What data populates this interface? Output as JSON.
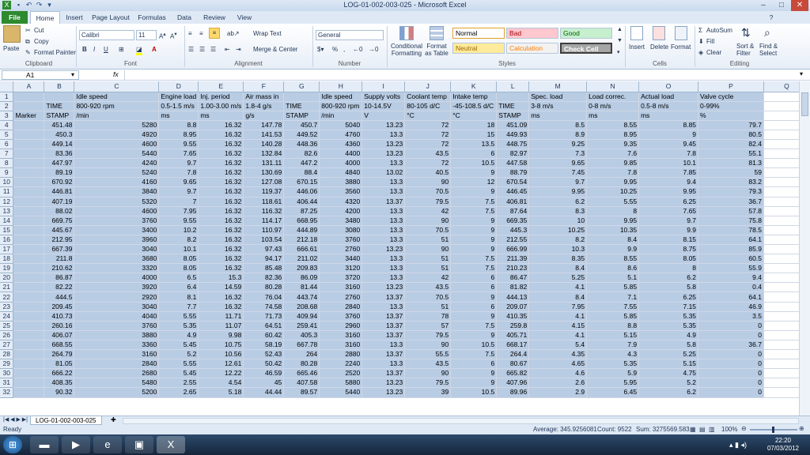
{
  "window": {
    "title": "LOG-01-002-003-025  -  Microsoft Excel"
  },
  "tabs": [
    "File",
    "Home",
    "Insert",
    "Page Layout",
    "Formulas",
    "Data",
    "Review",
    "View"
  ],
  "ribbon": {
    "clipboard": {
      "paste": "Paste",
      "cut": "Cut",
      "copy": "Copy",
      "format_painter": "Format Painter",
      "label": "Clipboard"
    },
    "font": {
      "name": "Calibri",
      "size": "11",
      "label": "Font",
      "bold": "B",
      "italic": "I",
      "underline": "U"
    },
    "alignment": {
      "wrap": "Wrap Text",
      "merge": "Merge & Center",
      "label": "Alignment"
    },
    "number": {
      "format": "General",
      "label": "Number",
      "percent": "%",
      "comma": ","
    },
    "styles": {
      "cond": "Conditional Formatting",
      "table": "Format as Table",
      "label": "Styles",
      "cells": [
        {
          "text": "Normal",
          "bg": "#ffffff",
          "fg": "#000000"
        },
        {
          "text": "Bad",
          "bg": "#ffc7ce",
          "fg": "#9c0006"
        },
        {
          "text": "Good",
          "bg": "#c6efce",
          "fg": "#006100"
        },
        {
          "text": "Neutral",
          "bg": "#ffeb9c",
          "fg": "#9c6500"
        },
        {
          "text": "Calculation",
          "bg": "#f2f2f2",
          "fg": "#fa7d00"
        },
        {
          "text": "Check Cell",
          "bg": "#a5a5a5",
          "fg": "#ffffff"
        }
      ]
    },
    "cells": {
      "insert": "Insert",
      "delete": "Delete",
      "format": "Format",
      "label": "Cells"
    },
    "editing": {
      "autosum": "AutoSum",
      "fill": "Fill",
      "clear": "Clear",
      "sort": "Sort & Filter",
      "find": "Find & Select",
      "label": "Editing"
    }
  },
  "namebox": "A1",
  "fx": "fx",
  "columns": [
    "A",
    "B",
    "C",
    "D",
    "E",
    "F",
    "G",
    "H",
    "I",
    "J",
    "K",
    "L",
    "M",
    "N",
    "O",
    "P",
    "Q"
  ],
  "header_rows": [
    [
      "",
      "",
      "Idle speed",
      "Engine load",
      "Inj. period",
      "Air mass in",
      "",
      "Idle speed",
      "Supply volts",
      "Coolant temp",
      "Intake temp",
      "",
      "Spec. load",
      "Load correc.",
      "Actual load",
      "Valve cycle",
      ""
    ],
    [
      "",
      "TIME",
      "800-920 rpm",
      "0.5-1.5 m/s",
      "1.00-3.00 m/s",
      "1.8-4 g/s",
      "TIME",
      "800-920 rpm",
      "10-14.5V",
      "80-105 d/C",
      "-45-108.5 d/C",
      "TIME",
      "3-8 m/s",
      "0-8 m/s",
      "0.5-8 m/s",
      "0-99%",
      ""
    ],
    [
      "Marker",
      "STAMP",
      "/min",
      "ms",
      "ms",
      "g/s",
      "STAMP",
      "/min",
      "V",
      "°C",
      "°C",
      "STAMP",
      "ms",
      "ms",
      "ms",
      "%",
      ""
    ]
  ],
  "data_rows": [
    [
      "451.48",
      "5280",
      "8.8",
      "16.32",
      "147.78",
      "450.7",
      "5040",
      "13.23",
      "72",
      "18",
      "451.09",
      "8.5",
      "8.55",
      "8.85",
      "79.7"
    ],
    [
      "450.3",
      "4920",
      "8.95",
      "16.32",
      "141.53",
      "449.52",
      "4760",
      "13.3",
      "72",
      "15",
      "449.93",
      "8.9",
      "8.95",
      "9",
      "80.5"
    ],
    [
      "449.14",
      "4600",
      "9.55",
      "16.32",
      "140.28",
      "448.36",
      "4360",
      "13.23",
      "72",
      "13.5",
      "448.75",
      "9.25",
      "9.35",
      "9.45",
      "82.4"
    ],
    [
      "83.36",
      "5440",
      "7.65",
      "16.32",
      "132.84",
      "82.6",
      "4400",
      "13.23",
      "43.5",
      "6",
      "82.97",
      "7.3",
      "7.6",
      "7.8",
      "55.1"
    ],
    [
      "447.97",
      "4240",
      "9.7",
      "16.32",
      "131.11",
      "447.2",
      "4000",
      "13.3",
      "72",
      "10.5",
      "447.58",
      "9.65",
      "9.85",
      "10.1",
      "81.3"
    ],
    [
      "89.19",
      "5240",
      "7.8",
      "16.32",
      "130.69",
      "88.4",
      "4840",
      "13.02",
      "40.5",
      "9",
      "88.79",
      "7.45",
      "7.8",
      "7.85",
      "59"
    ],
    [
      "670.92",
      "4160",
      "9.65",
      "16.32",
      "127.08",
      "670.15",
      "3880",
      "13.3",
      "90",
      "12",
      "670.54",
      "9.7",
      "9.95",
      "9.4",
      "83.2"
    ],
    [
      "446.81",
      "3840",
      "9.7",
      "16.32",
      "119.37",
      "446.06",
      "3560",
      "13.3",
      "70.5",
      "9",
      "446.45",
      "9.95",
      "10.25",
      "9.95",
      "79.3"
    ],
    [
      "407.19",
      "5320",
      "7",
      "16.32",
      "118.61",
      "406.44",
      "4320",
      "13.37",
      "79.5",
      "7.5",
      "406.81",
      "6.2",
      "5.55",
      "6.25",
      "36.7"
    ],
    [
      "88.02",
      "4600",
      "7.95",
      "16.32",
      "116.32",
      "87.25",
      "4200",
      "13.3",
      "42",
      "7.5",
      "87.64",
      "8.3",
      "8",
      "7.65",
      "57.8"
    ],
    [
      "669.75",
      "3760",
      "9.55",
      "16.32",
      "114.17",
      "668.95",
      "3480",
      "13.3",
      "90",
      "9",
      "669.35",
      "10",
      "9.95",
      "9.7",
      "75.8"
    ],
    [
      "445.67",
      "3400",
      "10.2",
      "16.32",
      "110.97",
      "444.89",
      "3080",
      "13.3",
      "70.5",
      "9",
      "445.3",
      "10.25",
      "10.35",
      "9.9",
      "78.5"
    ],
    [
      "212.95",
      "3960",
      "8.2",
      "16.32",
      "103.54",
      "212.18",
      "3760",
      "13.3",
      "51",
      "9",
      "212.55",
      "8.2",
      "8.4",
      "8.15",
      "64.1"
    ],
    [
      "667.39",
      "3040",
      "10.1",
      "16.32",
      "97.43",
      "666.61",
      "2760",
      "13.23",
      "90",
      "9",
      "666.99",
      "10.3",
      "9.9",
      "8.75",
      "85.9"
    ],
    [
      "211.8",
      "3680",
      "8.05",
      "16.32",
      "94.17",
      "211.02",
      "3440",
      "13.3",
      "51",
      "7.5",
      "211.39",
      "8.35",
      "8.55",
      "8.05",
      "60.5"
    ],
    [
      "210.62",
      "3320",
      "8.05",
      "16.32",
      "85.48",
      "209.83",
      "3120",
      "13.3",
      "51",
      "7.5",
      "210.23",
      "8.4",
      "8.6",
      "8",
      "55.9"
    ],
    [
      "86.87",
      "4000",
      "6.5",
      "15.3",
      "82.36",
      "86.09",
      "3720",
      "13.3",
      "42",
      "6",
      "86.47",
      "5.25",
      "5.1",
      "6.2",
      "9.4"
    ],
    [
      "82.22",
      "3920",
      "6.4",
      "14.59",
      "80.28",
      "81.44",
      "3160",
      "13.23",
      "43.5",
      "6",
      "81.82",
      "4.1",
      "5.85",
      "5.8",
      "0.4"
    ],
    [
      "444.5",
      "2920",
      "8.1",
      "16.32",
      "76.04",
      "443.74",
      "2760",
      "13.37",
      "70.5",
      "9",
      "444.13",
      "8.4",
      "7.1",
      "6.25",
      "64.1"
    ],
    [
      "209.45",
      "3040",
      "7.7",
      "16.32",
      "74.58",
      "208.68",
      "2840",
      "13.3",
      "51",
      "6",
      "209.07",
      "7.95",
      "7.55",
      "7.15",
      "46.9"
    ],
    [
      "410.73",
      "4040",
      "5.55",
      "11.71",
      "71.73",
      "409.94",
      "3760",
      "13.37",
      "78",
      "9",
      "410.35",
      "4.1",
      "5.85",
      "5.35",
      "3.5"
    ],
    [
      "260.16",
      "3760",
      "5.35",
      "11.07",
      "64.51",
      "259.41",
      "2960",
      "13.37",
      "57",
      "7.5",
      "259.8",
      "4.15",
      "8.8",
      "5.35",
      "0"
    ],
    [
      "406.07",
      "3880",
      "4.9",
      "9.98",
      "60.42",
      "405.3",
      "3160",
      "13.37",
      "79.5",
      "9",
      "405.71",
      "4.1",
      "5.15",
      "4.9",
      "0"
    ],
    [
      "668.55",
      "3360",
      "5.45",
      "10.75",
      "58.19",
      "667.78",
      "3160",
      "13.3",
      "90",
      "10.5",
      "668.17",
      "5.4",
      "7.9",
      "5.8",
      "36.7"
    ],
    [
      "264.79",
      "3160",
      "5.2",
      "10.56",
      "52.43",
      "264",
      "2880",
      "13.37",
      "55.5",
      "7.5",
      "264.4",
      "4.35",
      "4.3",
      "5.25",
      "0"
    ],
    [
      "81.05",
      "2840",
      "5.55",
      "12.61",
      "50.42",
      "80.28",
      "2240",
      "13.3",
      "43.5",
      "6",
      "80.67",
      "4.65",
      "5.35",
      "5.15",
      "0"
    ],
    [
      "666.22",
      "2680",
      "5.45",
      "12.22",
      "46.59",
      "665.46",
      "2520",
      "13.37",
      "90",
      "9",
      "665.82",
      "4.6",
      "5.9",
      "4.75",
      "0"
    ],
    [
      "408.35",
      "5480",
      "2.55",
      "4.54",
      "45",
      "407.58",
      "5880",
      "13.23",
      "79.5",
      "9",
      "407.96",
      "2.6",
      "5.95",
      "5.2",
      "0"
    ],
    [
      "90.32",
      "5200",
      "2.65",
      "5.18",
      "44.44",
      "89.57",
      "5440",
      "13.23",
      "39",
      "10.5",
      "89.96",
      "2.9",
      "6.45",
      "6.2",
      "0"
    ]
  ],
  "row_numbers": [
    "1",
    "2",
    "3",
    "4",
    "5",
    "6",
    "7",
    "8",
    "9",
    "10",
    "11",
    "12",
    "13",
    "14",
    "15",
    "16",
    "17",
    "18",
    "19",
    "20",
    "21",
    "22",
    "23",
    "24",
    "25",
    "26",
    "27",
    "28",
    "29",
    "30",
    "31",
    "32"
  ],
  "sheet_tab": "LOG-01-002-003-025",
  "status": {
    "ready": "Ready",
    "average": "Average: 345.9256081",
    "count": "Count: 9522",
    "sum": "Sum: 3275569.583",
    "zoom": "100%"
  },
  "clock": {
    "time": "22:20",
    "date": "07/03/2012"
  }
}
